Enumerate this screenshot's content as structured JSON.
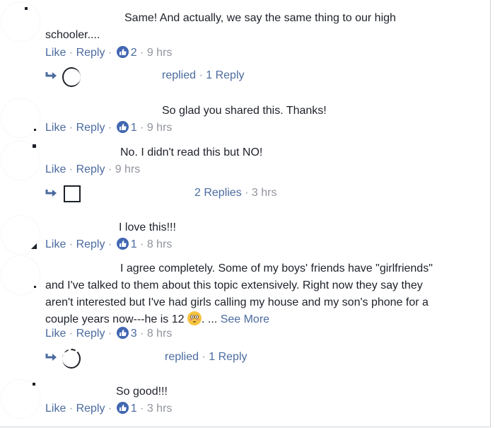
{
  "comments": [
    {
      "text_line1": "Same! And actually, we say the same thing to our high",
      "text_line2": "schooler....",
      "like": "Like",
      "reply": "Reply",
      "likes": "2",
      "time": "9 hrs",
      "reply_summary": {
        "text": "replied",
        "count": "1 Reply"
      }
    },
    {
      "text_line1": "So glad you shared this. Thanks!",
      "like": "Like",
      "reply": "Reply",
      "likes": "1",
      "time": "9 hrs"
    },
    {
      "text_line1": "No. I didn't read this but NO!",
      "like": "Like",
      "reply": "Reply",
      "time": "9 hrs",
      "reply_summary": {
        "count": "2 Replies",
        "time": "3 hrs"
      }
    },
    {
      "text_line1": "I love this!!!",
      "like": "Like",
      "reply": "Reply",
      "likes": "1",
      "time": "8 hrs"
    },
    {
      "text_line1": "I agree completely. Some of my boys' friends have \"girlfriends\"",
      "text_line2": "and I've talked to them about this topic extensively. Right now they say they",
      "text_line3": "aren't interested but I've had girls calling my house and my son's phone for a",
      "text_line4": "couple years now---he is 12",
      "ellipsis": ". ...",
      "see_more": "See More",
      "like": "Like",
      "reply": "Reply",
      "likes": "3",
      "time": "8 hrs",
      "reply_summary": {
        "text": "replied",
        "count": "1 Reply"
      }
    },
    {
      "text_line1": "So good!!!",
      "like": "Like",
      "reply": "Reply",
      "likes": "1",
      "time": "3 hrs"
    }
  ],
  "icons": {
    "like": "thumbs-up-icon",
    "reply_arrow": "reply-arrow-icon",
    "emoji": "flushed-face-emoji"
  },
  "colors": {
    "link": "#4b6b9f",
    "meta": "#90949c",
    "text": "#1d2129",
    "like_badge": "#4267b2"
  }
}
